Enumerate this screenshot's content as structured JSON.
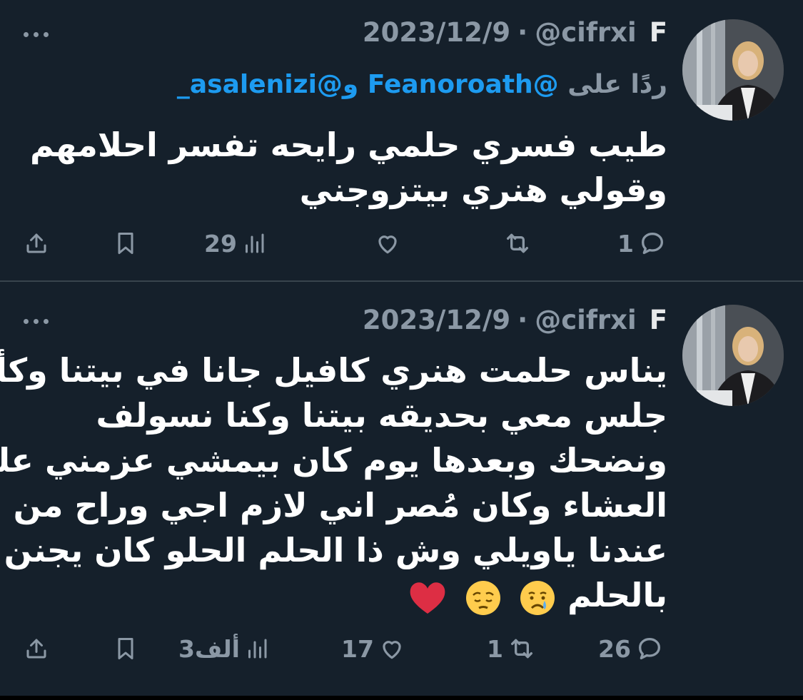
{
  "tweets": [
    {
      "name": "F",
      "handle": "@cifrxi",
      "dot": "·",
      "date": "2023/12/9",
      "reply": {
        "prefix": "ردًا على",
        "mention1": "@Feanoroath",
        "conjunction": "و",
        "mention2": "@asalenizi_"
      },
      "lines": [
        "طيب فسري حلمي رايحه تفسر احلامهم",
        "وقولي هنري بيتزوجني"
      ],
      "actions": {
        "replies": "1",
        "retweets": "",
        "likes": "",
        "views": "29"
      }
    },
    {
      "name": "F",
      "handle": "@cifrxi",
      "dot": "·",
      "date": "2023/12/9",
      "lines": [
        "يناس حلمت هنري كافيل جانا في بيتنا وكأنه",
        "جلس معي بحديقه بيتنا وكنا نسولف",
        "ونضحك وبعدها يوم كان بيمشي عزمني على",
        "العشاء وكان مُصر اني لازم اجي وراح من",
        "عندنا ياويلي وش ذا الحلم الحلو كان يجنن",
        "بالحلم"
      ],
      "emojis": [
        "crying-face",
        "pensive-face",
        "red-heart"
      ],
      "actions": {
        "replies": "26",
        "retweets": "1",
        "likes": "17",
        "views": "3ألف"
      }
    }
  ],
  "colors": {
    "background": "#15202b",
    "secondary_text": "#8b98a5",
    "mention": "#1d9bf0",
    "divider": "#38444d"
  },
  "icons": [
    "more-icon",
    "share-icon",
    "bookmark-icon",
    "views-icon",
    "like-icon",
    "retweet-icon",
    "reply-icon"
  ]
}
